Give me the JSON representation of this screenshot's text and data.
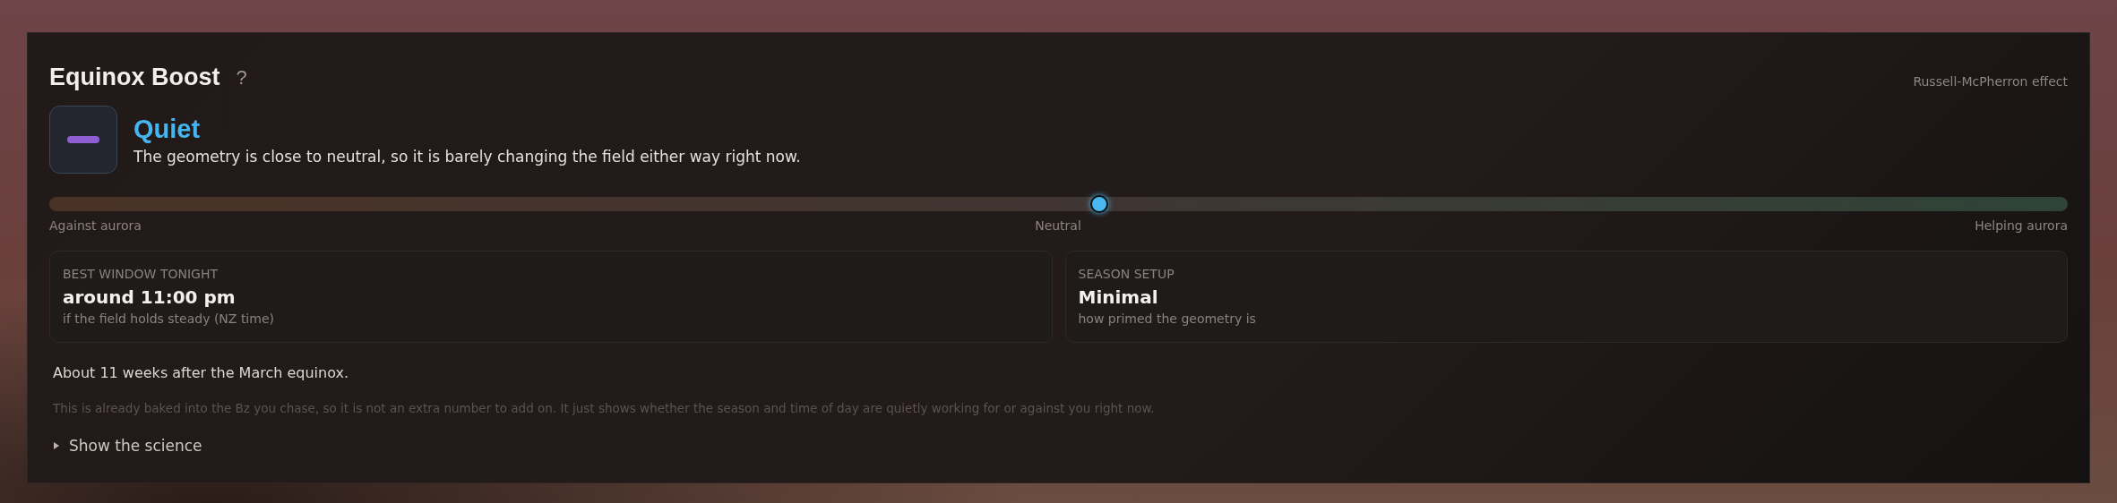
{
  "title": "Equinox Boost",
  "help": "?",
  "badge": "Russell-McPherron effect",
  "status": {
    "label": "Quiet",
    "description": "The geometry is close to neutral, so it is barely changing the field either way right now."
  },
  "gauge": {
    "level": 0.52,
    "labels": [
      "Against aurora",
      "Neutral",
      "Helping aurora"
    ]
  },
  "cards": [
    {
      "label": "BEST WINDOW TONIGHT",
      "value": "around 11:00 pm",
      "note": "if the field holds steady (NZ time)"
    },
    {
      "label": "SEASON SETUP",
      "value": "Minimal",
      "note": "how primed the geometry is"
    }
  ],
  "summary": "About 11 weeks after the March equinox.",
  "disclaimer": "This is already baked into the Bz you chase, so it is not an extra number to add on. It just shows whether the season and time of day are quietly working for or against you right now.",
  "disclosure": {
    "label": "Show the science",
    "expanded": false
  }
}
